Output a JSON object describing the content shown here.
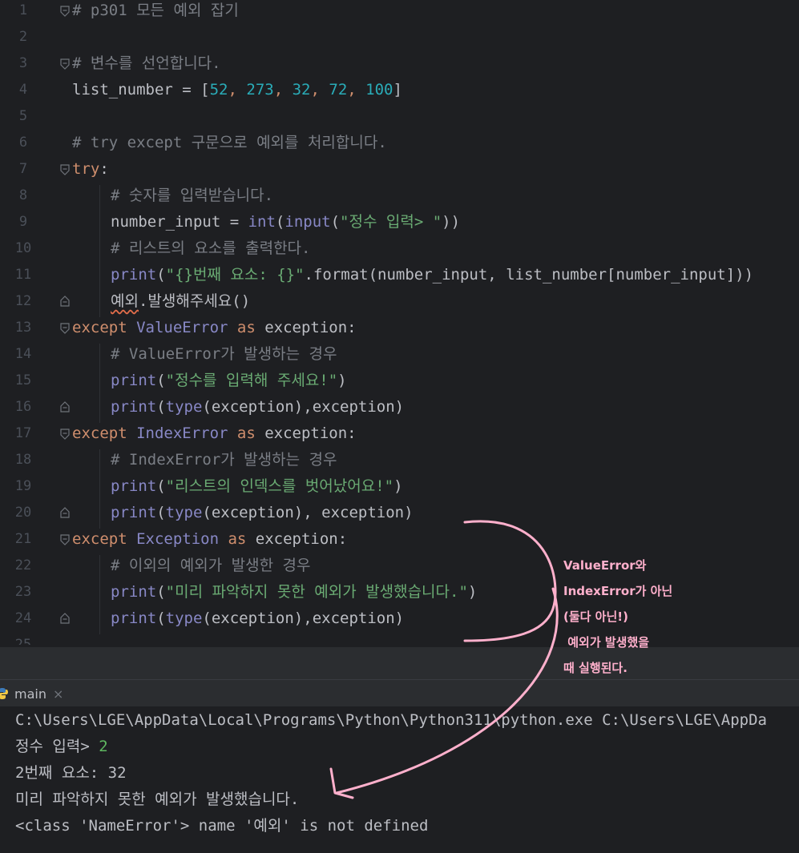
{
  "editor": {
    "line_numbers": [
      "1",
      "2",
      "3",
      "4",
      "5",
      "6",
      "7",
      "8",
      "9",
      "10",
      "11",
      "12",
      "13",
      "14",
      "15",
      "16",
      "17",
      "18",
      "19",
      "20",
      "21",
      "22",
      "23",
      "24"
    ],
    "lines": {
      "l1": "# p301 모든 예외 잡기",
      "l3": "# 변수를 선언합니다.",
      "l4_a": "list_number = [",
      "l4_n1": "52",
      "l4_c1": ", ",
      "l4_n2": "273",
      "l4_c2": ", ",
      "l4_n3": "32",
      "l4_c3": ", ",
      "l4_n4": "72",
      "l4_c4": ", ",
      "l4_n5": "100",
      "l4_b": "]",
      "l6": "# try except 구문으로 예외를 처리합니다.",
      "l7_kw": "try",
      "l7_b": ":",
      "l8": "# 숫자를 입력받습니다.",
      "l9_a": "number_input = ",
      "l9_int": "int",
      "l9_p1": "(",
      "l9_input": "input",
      "l9_p2": "(",
      "l9_str": "\"정수 입력> \"",
      "l9_p3": "))",
      "l10": "# 리스트의 요소를 출력한다.",
      "l11_print": "print",
      "l11_p": "(",
      "l11_str": "\"{}번째 요소: {}\"",
      "l11_rest": ".format(number_input, list_number[number_input]))",
      "l12_a": "예외",
      "l12_b": ".발생해주세요()",
      "l13_kw": "except ",
      "l13_cls": "ValueError",
      "l13_as": " as ",
      "l13_rest": "exception:",
      "l14": "# ValueError가 발생하는 경우",
      "l15_print": "print",
      "l15_p": "(",
      "l15_str": "\"정수를 입력해 주세요!\"",
      "l15_e": ")",
      "l16_print": "print",
      "l16_p": "(",
      "l16_type": "type",
      "l16_rest": "(exception),exception)",
      "l17_kw": "except ",
      "l17_cls": "IndexError",
      "l17_as": " as ",
      "l17_rest": "exception:",
      "l18": "# IndexError가 발생하는 경우",
      "l19_print": "print",
      "l19_p": "(",
      "l19_str": "\"리스트의 인덱스를 벗어났어요!\"",
      "l19_e": ")",
      "l20_print": "print",
      "l20_p": "(",
      "l20_type": "type",
      "l20_rest": "(exception), exception)",
      "l21_kw": "except ",
      "l21_cls": "Exception",
      "l21_as": " as ",
      "l21_rest": "exception:",
      "l22": "# 이외의 예외가 발생한 경우",
      "l23_print": "print",
      "l23_p": "(",
      "l23_str": "\"미리 파악하지 못한 예외가 발생했습니다.\"",
      "l23_e": ")",
      "l24_print": "print",
      "l24_p": "(",
      "l24_type": "type",
      "l24_rest": "(exception),exception)"
    }
  },
  "run_panel": {
    "tab_label": "main",
    "tab_close": "×",
    "output": {
      "cmd": "C:\\Users\\LGE\\AppData\\Local\\Programs\\Python\\Python311\\python.exe C:\\Users\\LGE\\AppDa",
      "prompt": "정수 입력> ",
      "prompt_input": "2",
      "line3": "2번째 요소: 32",
      "line4": "미리 파악하지 못한 예외가 발생했습니다.",
      "line5": "<class 'NameError'> name '예외' is not defined"
    }
  },
  "annotation": {
    "note": "ValueError와\nIndexError가 아닌\n(둘다 아닌!)\n 예외가 발생했을\n때 실행된다.",
    "color": "#ffb0cc"
  },
  "colors": {
    "background": "#1e1f22",
    "keyword": "#cf8e6d",
    "number": "#2aacb8",
    "string": "#6aab73",
    "comment": "#7a7e85",
    "builtin": "#8888c6"
  }
}
